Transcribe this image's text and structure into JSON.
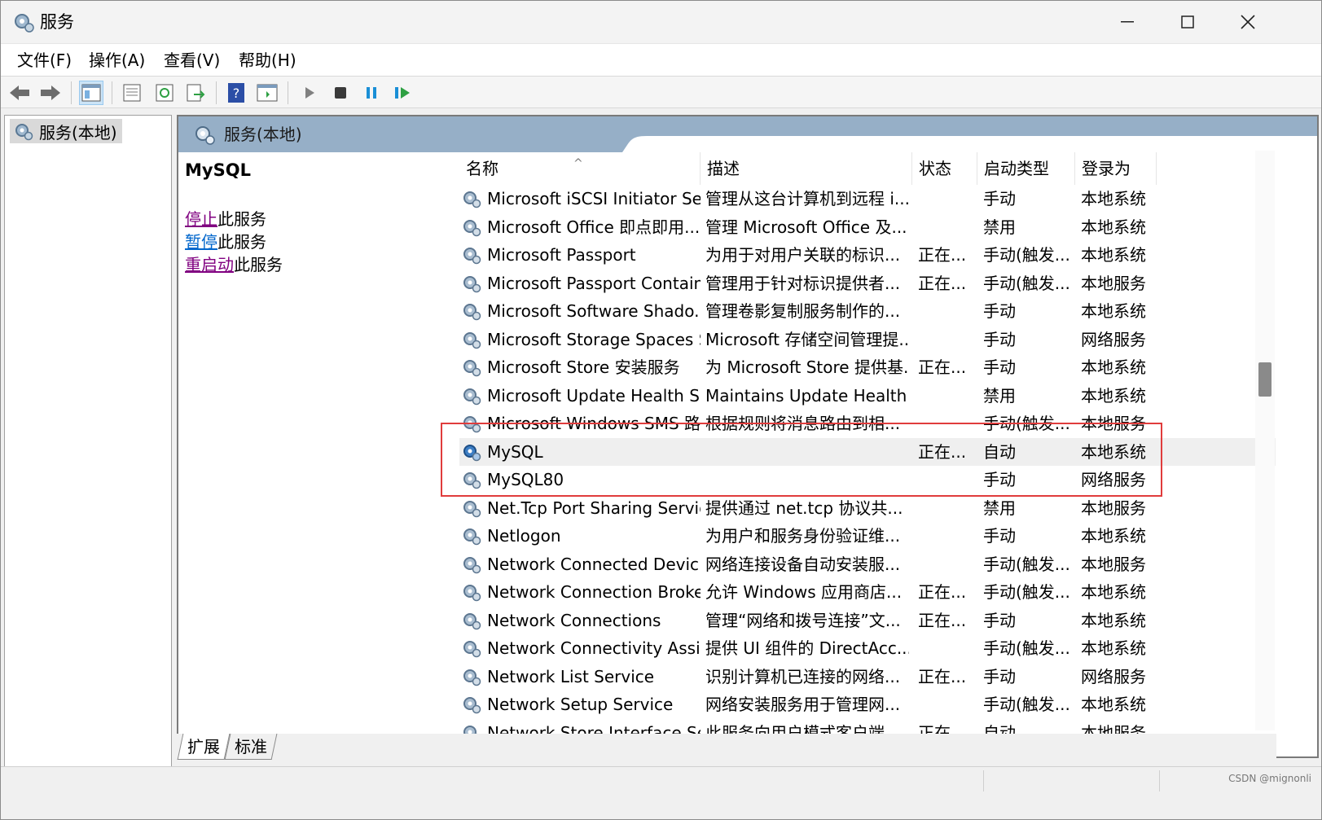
{
  "window": {
    "title": "服务",
    "minimize": "—",
    "maximize": "☐",
    "close": "✕"
  },
  "menu": [
    {
      "label": "文件(F)"
    },
    {
      "label": "操作(A)"
    },
    {
      "label": "查看(V)"
    },
    {
      "label": "帮助(H)"
    }
  ],
  "toolbar": {
    "icons": [
      "back-icon",
      "forward-icon",
      "show-hide-tree-icon",
      "properties-icon",
      "refresh-icon",
      "export-icon",
      "help-icon",
      "console-icon",
      "start-service-icon",
      "stop-service-icon",
      "pause-service-icon",
      "restart-service-icon"
    ]
  },
  "tree": {
    "node_label": "服务(本地)"
  },
  "content_header": {
    "title": "服务(本地)"
  },
  "extended_panel": {
    "service_name": "MySQL",
    "actions": [
      {
        "link": "停止",
        "suffix": "此服务"
      },
      {
        "link": "暂停",
        "suffix": "此服务"
      },
      {
        "link": "重启动",
        "suffix": "此服务"
      }
    ]
  },
  "columns": {
    "name": "名称",
    "description": "描述",
    "status": "状态",
    "startup_type": "启动类型",
    "logon_as": "登录为"
  },
  "services": [
    {
      "name": "Microsoft iSCSI Initiator Ser...",
      "description": "管理从这台计算机到远程 i...",
      "status": "",
      "startup": "手动",
      "logon": "本地系统"
    },
    {
      "name": "Microsoft Office 即点即用...",
      "description": "管理 Microsoft Office 及...",
      "status": "",
      "startup": "禁用",
      "logon": "本地系统"
    },
    {
      "name": "Microsoft Passport",
      "description": "为用于对用户关联的标识...",
      "status": "正在...",
      "startup": "手动(触发...",
      "logon": "本地系统"
    },
    {
      "name": "Microsoft Passport Container",
      "description": "管理用于针对标识提供者...",
      "status": "正在...",
      "startup": "手动(触发...",
      "logon": "本地服务"
    },
    {
      "name": "Microsoft Software Shado...",
      "description": "管理卷影复制服务制作的...",
      "status": "",
      "startup": "手动",
      "logon": "本地系统"
    },
    {
      "name": "Microsoft Storage Spaces S...",
      "description": "Microsoft 存储空间管理提...",
      "status": "",
      "startup": "手动",
      "logon": "网络服务"
    },
    {
      "name": "Microsoft Store 安装服务",
      "description": "为 Microsoft Store 提供基...",
      "status": "正在...",
      "startup": "手动",
      "logon": "本地系统"
    },
    {
      "name": "Microsoft Update Health S...",
      "description": "Maintains Update Health",
      "status": "",
      "startup": "禁用",
      "logon": "本地系统"
    },
    {
      "name": "Microsoft Windows SMS 路...",
      "description": "根据规则将消息路由到相...",
      "status": "",
      "startup": "手动(触发...",
      "logon": "本地服务"
    },
    {
      "name": "MySQL",
      "description": "",
      "status": "正在...",
      "startup": "自动",
      "logon": "本地系统",
      "selected": true
    },
    {
      "name": "MySQL80",
      "description": "",
      "status": "",
      "startup": "手动",
      "logon": "网络服务"
    },
    {
      "name": "Net.Tcp Port Sharing Service",
      "description": "提供通过 net.tcp 协议共...",
      "status": "",
      "startup": "禁用",
      "logon": "本地服务"
    },
    {
      "name": "Netlogon",
      "description": "为用户和服务身份验证维...",
      "status": "",
      "startup": "手动",
      "logon": "本地系统"
    },
    {
      "name": "Network Connected Devic...",
      "description": "网络连接设备自动安装服...",
      "status": "",
      "startup": "手动(触发...",
      "logon": "本地服务"
    },
    {
      "name": "Network Connection Broker",
      "description": "允许 Windows 应用商店...",
      "status": "正在...",
      "startup": "手动(触发...",
      "logon": "本地系统"
    },
    {
      "name": "Network Connections",
      "description": "管理“网络和拨号连接”文...",
      "status": "正在...",
      "startup": "手动",
      "logon": "本地系统"
    },
    {
      "name": "Network Connectivity Assis...",
      "description": "提供 UI 组件的 DirectAcc...",
      "status": "",
      "startup": "手动(触发...",
      "logon": "本地系统"
    },
    {
      "name": "Network List Service",
      "description": "识别计算机已连接的网络...",
      "status": "正在...",
      "startup": "手动",
      "logon": "网络服务"
    },
    {
      "name": "Network Setup Service",
      "description": "网络安装服务用于管理网...",
      "status": "",
      "startup": "手动(触发...",
      "logon": "本地系统"
    },
    {
      "name": "Network Store Interface Se...",
      "description": "此服务向用户模式客户端...",
      "status": "正在...",
      "startup": "自动",
      "logon": "本地服务"
    }
  ],
  "bottom_tabs": [
    {
      "label": "扩展"
    },
    {
      "label": "标准"
    }
  ],
  "watermark": "CSDN @mignonli",
  "colors": {
    "header_bg": "#96afc7",
    "highlight_border": "#e03c3c",
    "link_visited": "#800080",
    "link": "#0066cc"
  }
}
